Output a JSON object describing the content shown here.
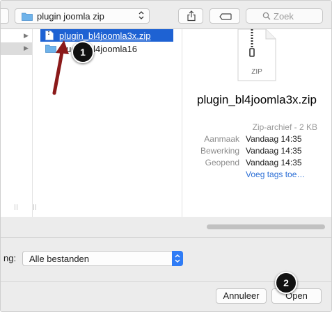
{
  "toolbar": {
    "location": "plugin joomla zip",
    "search_placeholder": "Zoek"
  },
  "files": [
    {
      "name": "plugin_bl4joomla3x.zip",
      "type": "zip",
      "selected": true
    },
    {
      "name": "plugin_bl4joomla16",
      "type": "folder",
      "selected": false
    }
  ],
  "preview": {
    "icon_label": "ZIP",
    "name": "plugin_bl4joomla3x.zip",
    "kind": "Zip-archief - 2 KB",
    "meta": [
      {
        "key": "Aanmaak",
        "value": "Vandaag 14:35"
      },
      {
        "key": "Bewerking",
        "value": "Vandaag 14:35"
      },
      {
        "key": "Geopend",
        "value": "Vandaag 14:35"
      }
    ],
    "tags_link": "Voeg tags toe…"
  },
  "bottom": {
    "format_label": "ng:",
    "format_value": "Alle bestanden",
    "cancel_label": "Annuleer",
    "open_label": "Open"
  },
  "annotations": [
    "1",
    "2"
  ],
  "colors": {
    "selection": "#1e62d3",
    "link": "#2c6fd6",
    "accent_stepper": "#2f7cf6",
    "annotation_arrow": "#8b1a1a"
  }
}
